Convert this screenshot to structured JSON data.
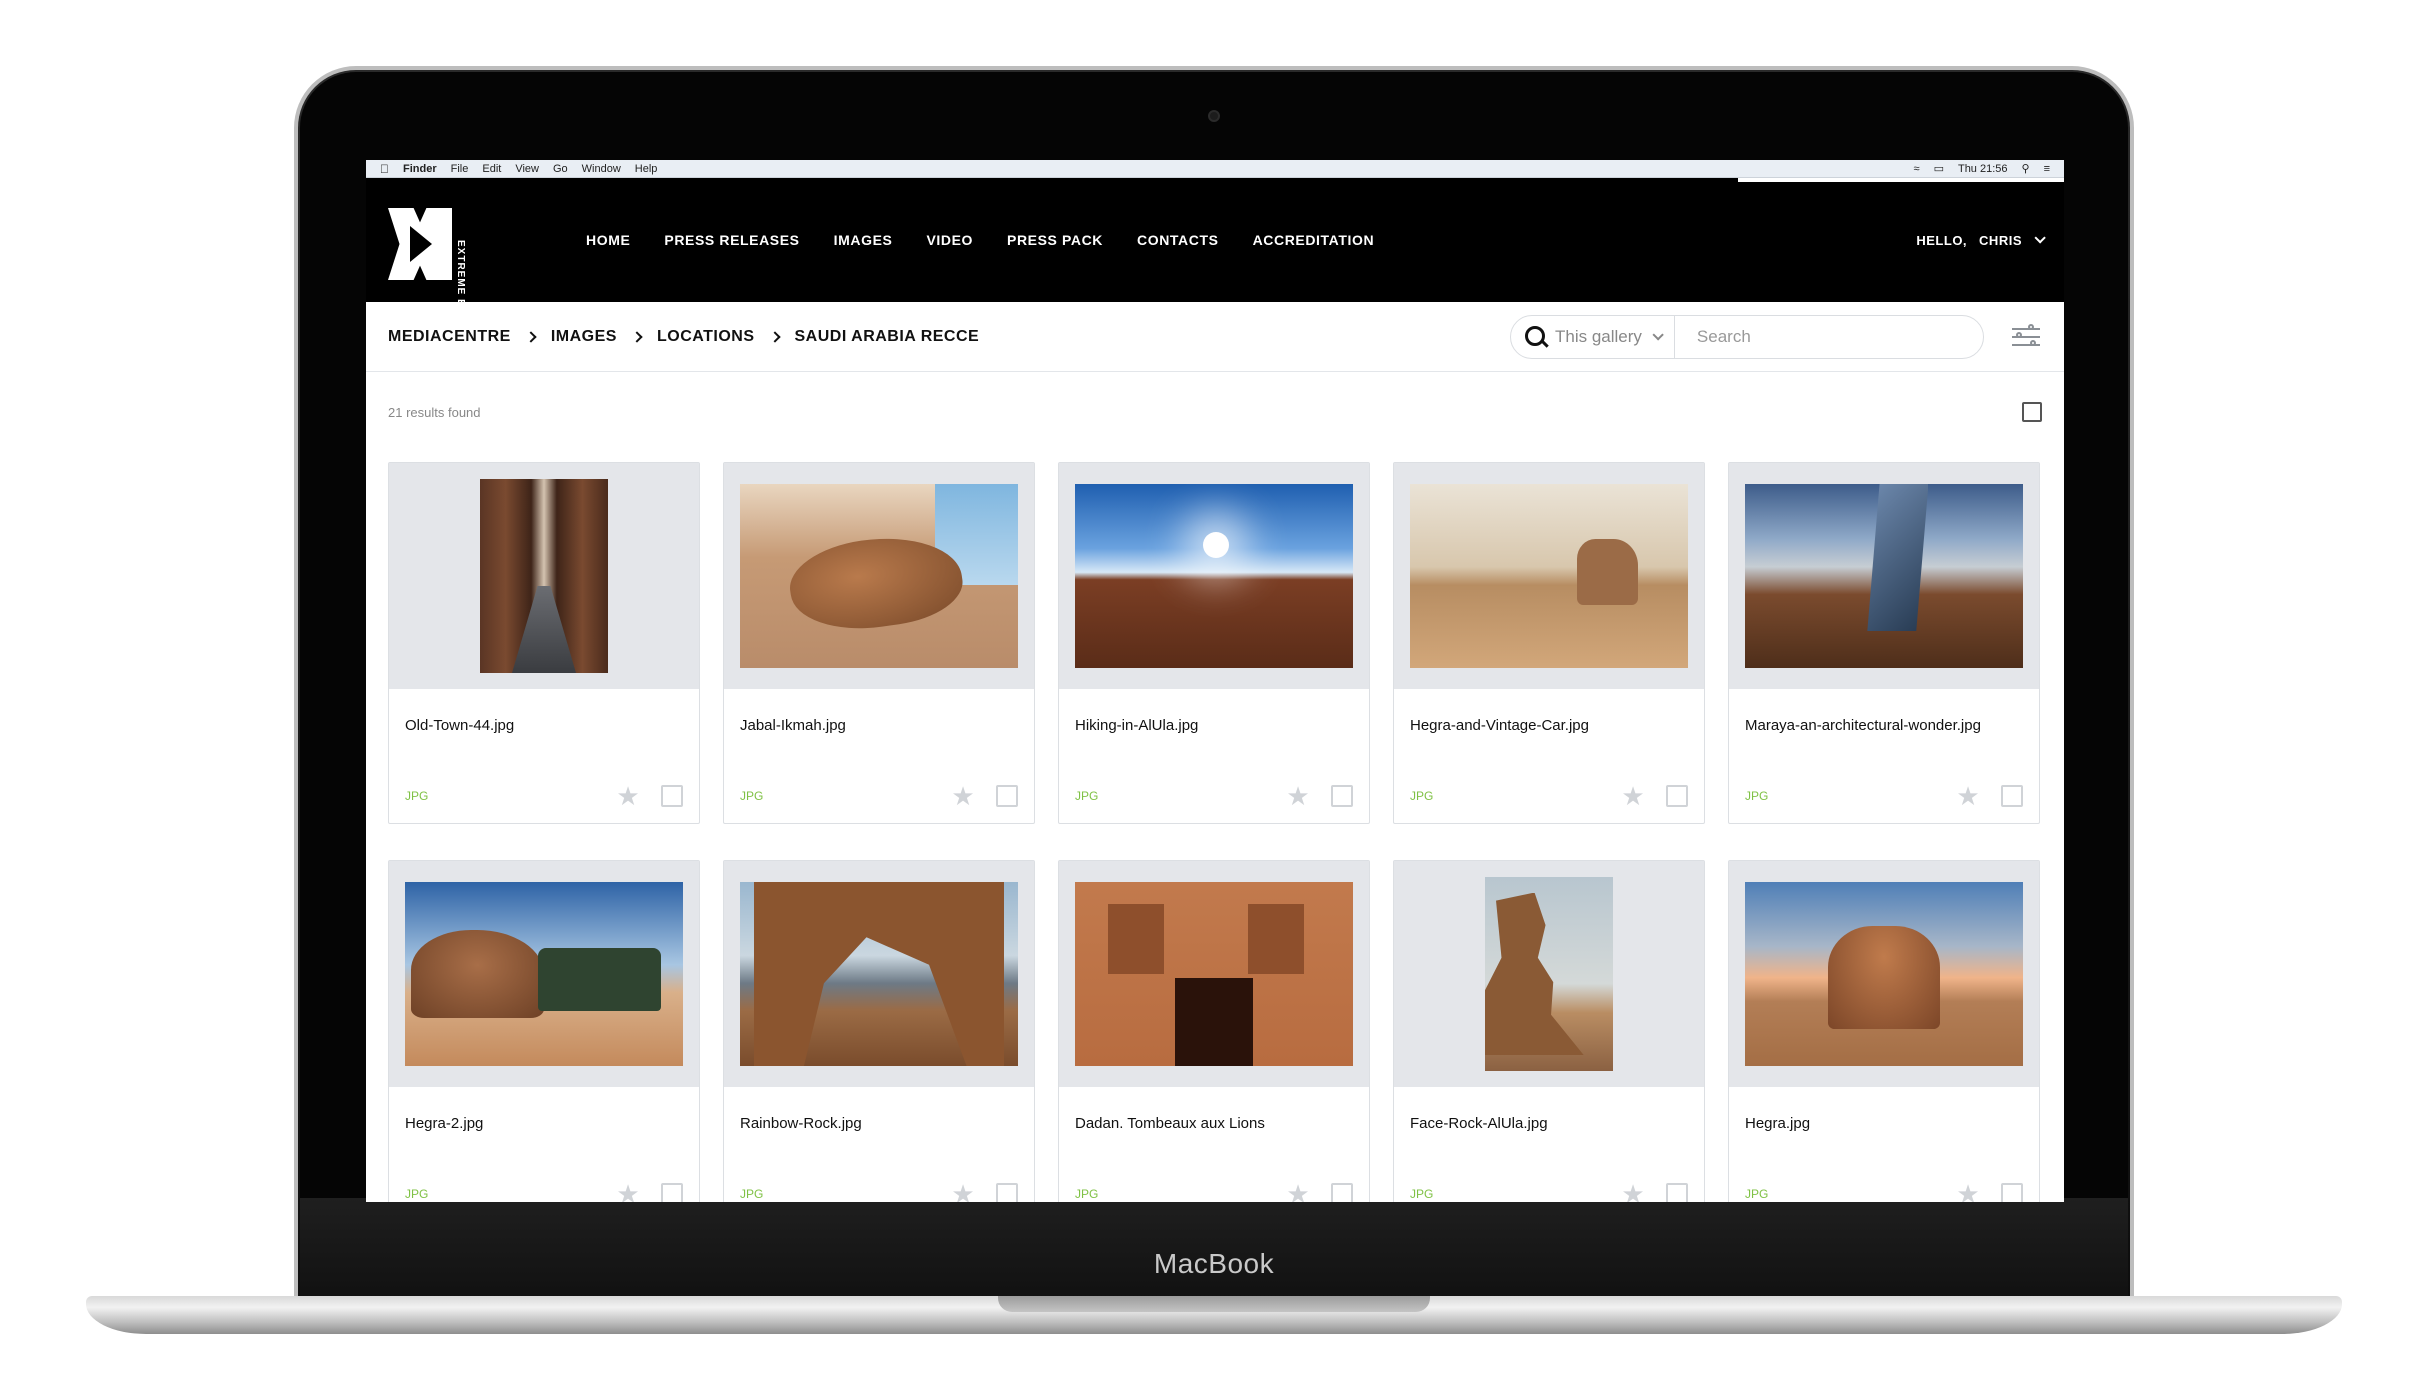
{
  "device": {
    "label": "MacBook"
  },
  "menubar": {
    "app": "Finder",
    "items": [
      "File",
      "Edit",
      "View",
      "Go",
      "Window",
      "Help"
    ],
    "clock": "Thu 21:56"
  },
  "header": {
    "logo_text": "EXTREME E",
    "nav": [
      "HOME",
      "PRESS RELEASES",
      "IMAGES",
      "VIDEO",
      "PRESS PACK",
      "CONTACTS",
      "ACCREDITATION"
    ],
    "greeting": "HELLO,",
    "user": "CHRIS"
  },
  "breadcrumb": [
    "MEDIACENTRE",
    "IMAGES",
    "LOCATIONS",
    "SAUDI ARABIA RECCE"
  ],
  "search": {
    "scope": "This gallery",
    "placeholder": "Search",
    "value": ""
  },
  "results": {
    "count_text": "21 results found"
  },
  "colors": {
    "filetype_green": "#7fc144",
    "header_bg": "#000000",
    "thumb_bg": "#e4e6ea"
  },
  "gallery": [
    {
      "title": "Old-Town-44.jpg",
      "type": "JPG",
      "photo": "alley"
    },
    {
      "title": "Jabal-Ikmah.jpg",
      "type": "JPG",
      "photo": "rock"
    },
    {
      "title": "Hiking-in-AlUla.jpg",
      "type": "JPG",
      "photo": "hike"
    },
    {
      "title": "Hegra-and-Vintage-Car.jpg",
      "type": "JPG",
      "photo": "car"
    },
    {
      "title": "Maraya-an-architectural-wonder.jpg",
      "type": "JPG",
      "photo": "mirror"
    },
    {
      "title": "Hegra-2.jpg",
      "type": "JPG",
      "photo": "hegra2"
    },
    {
      "title": "Rainbow-Rock.jpg",
      "type": "JPG",
      "photo": "arch"
    },
    {
      "title": "Dadan. Tombeaux aux Lions",
      "type": "JPG",
      "photo": "tombs"
    },
    {
      "title": "Face-Rock-AlUla.jpg",
      "type": "JPG",
      "photo": "face"
    },
    {
      "title": "Hegra.jpg",
      "type": "JPG",
      "photo": "hegra"
    }
  ]
}
